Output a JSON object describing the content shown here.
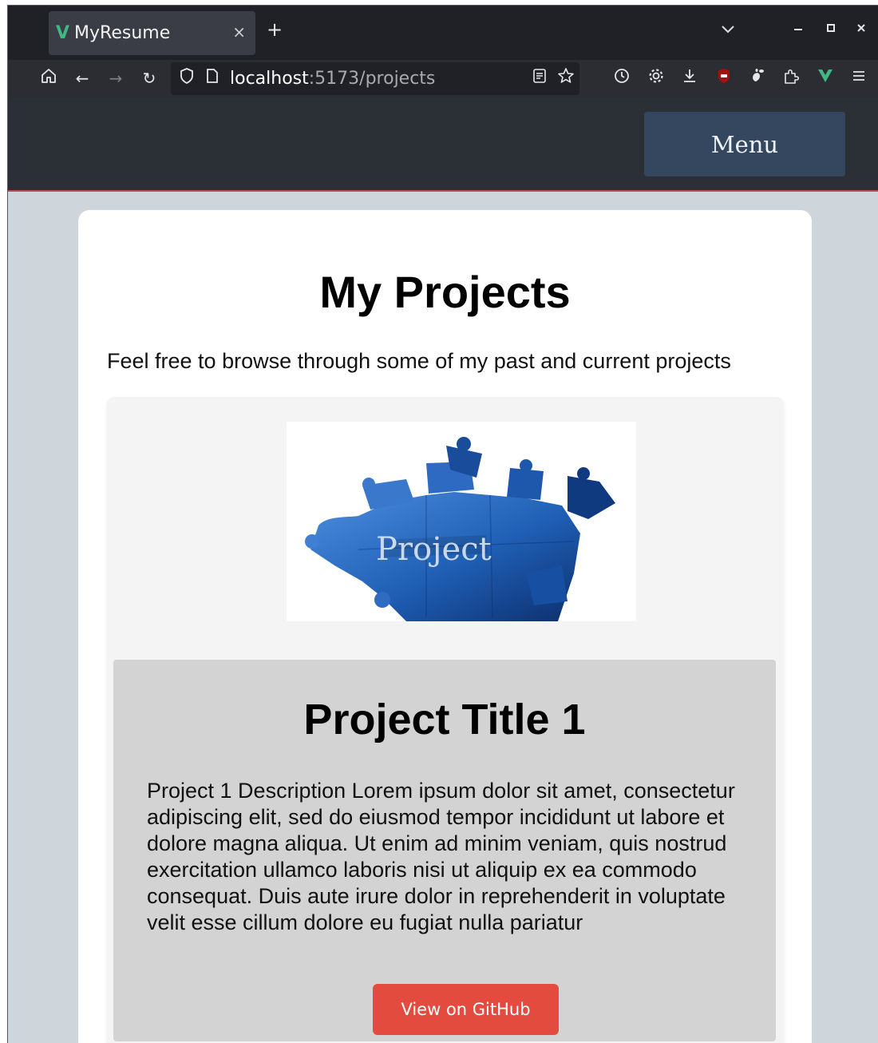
{
  "browser": {
    "tab": {
      "favicon": "V",
      "title": "MyResume",
      "close": "×"
    },
    "new_tab": "+",
    "tab_list": "⌄",
    "window_controls": {
      "minimize": "‒",
      "maximize": "▫",
      "close": "✕"
    },
    "nav": {
      "home": "⌂",
      "back": "←",
      "forward": "→",
      "reload": "↻"
    },
    "url": {
      "host": "localhost",
      "path": ":5173/projects"
    },
    "toolbar_icons": [
      "reader-view-icon",
      "bookmark-star-icon",
      "history-icon",
      "settings-icon",
      "download-icon",
      "ublock-icon",
      "gnome-icon",
      "extensions-icon",
      "vue-devtools-icon",
      "hamburger-menu-icon"
    ]
  },
  "site_header": {
    "menu_label": "Menu"
  },
  "page": {
    "title": "My Projects",
    "intro": "Feel free to browse through some of my past and current projects"
  },
  "projects": [
    {
      "image_text": "Project",
      "title": "Project Title 1",
      "description": "Project 1 Description Lorem ipsum dolor sit amet, consectetur adipiscing elit, sed do eiusmod tempor incididunt ut labore et dolore magna aliqua. Ut enim ad minim veniam, quis nostrud exercitation ullamco laboris nisi ut aliquip ex ea commodo consequat. Duis aute irure dolor in reprehenderit in voluptate velit esse cillum dolore eu fugiat nulla pariatur",
      "button_label": "View on GitHub"
    }
  ],
  "colors": {
    "accent_button": "#e34b3e",
    "menu_button": "#34475e",
    "vue_green": "#41b883",
    "puzzle_blue": "#1f5fb5"
  }
}
